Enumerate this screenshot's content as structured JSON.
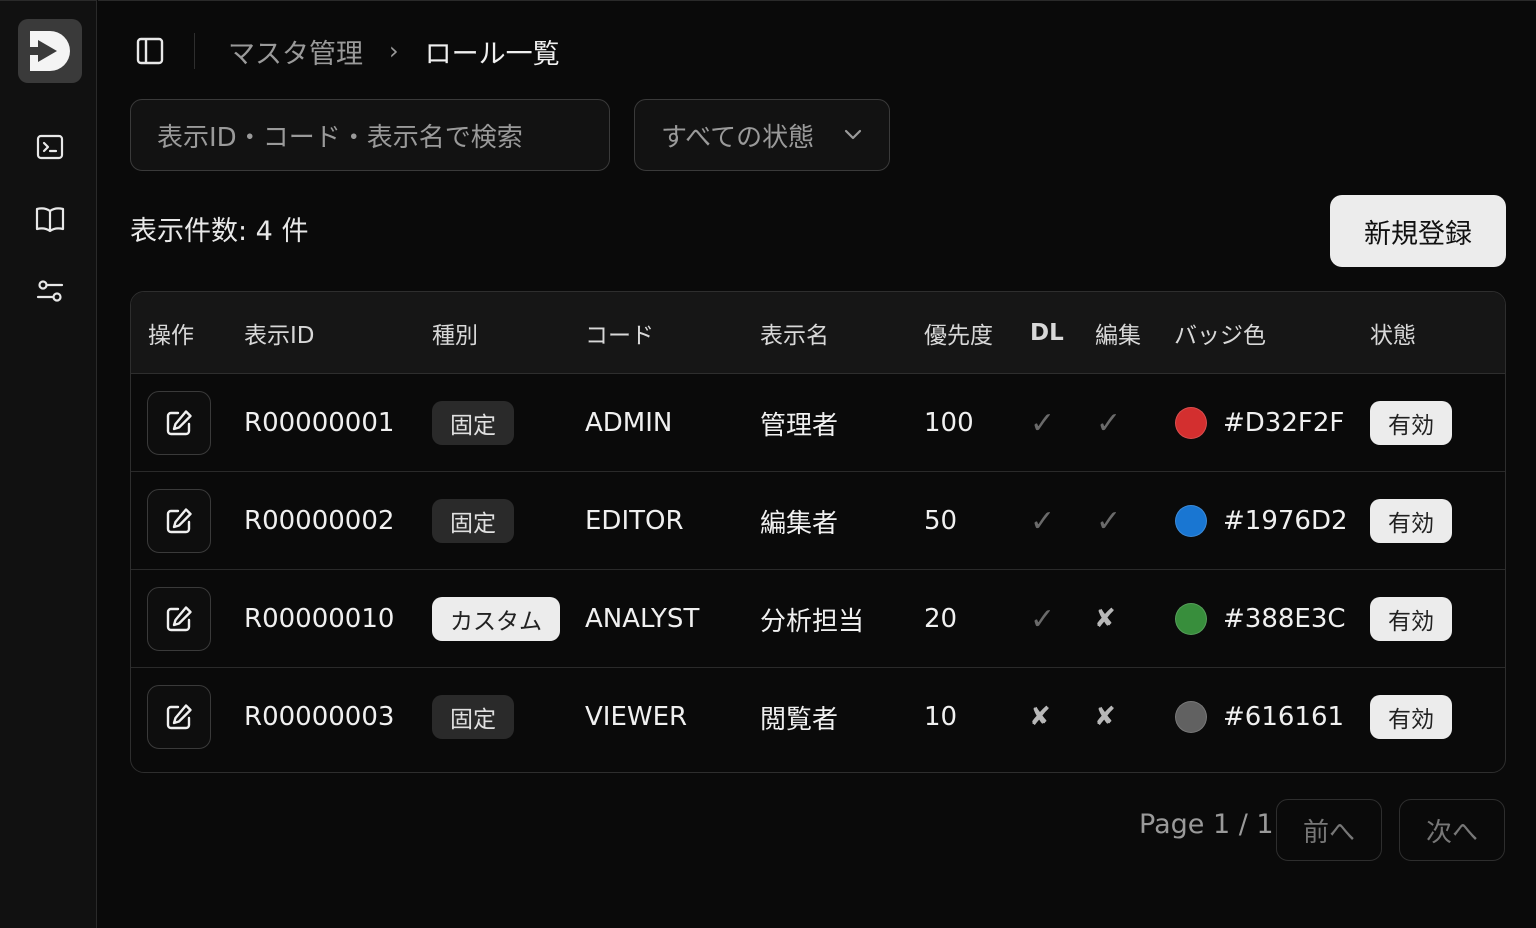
{
  "breadcrumb": {
    "parent": "マスタ管理",
    "separator": "›",
    "current": "ロール一覧"
  },
  "search": {
    "placeholder": "表示ID・コード・表示名で検索"
  },
  "filter": {
    "selected": "すべての状態"
  },
  "count_label": "表示件数: 4 件",
  "new_button": "新規登録",
  "table": {
    "headers": {
      "action": "操作",
      "display_id": "表示ID",
      "type": "種別",
      "code": "コード",
      "display_name": "表示名",
      "priority": "優先度",
      "dl": "DL",
      "edit": "編集",
      "badge_color": "バッジ色",
      "status": "状態"
    },
    "rows": [
      {
        "display_id": "R00000001",
        "type": "固定",
        "type_kind": "fixed",
        "code": "ADMIN",
        "display_name": "管理者",
        "priority": "100",
        "dl": true,
        "edit": true,
        "badge_color": "#D32F2F",
        "status": "有効"
      },
      {
        "display_id": "R00000002",
        "type": "固定",
        "type_kind": "fixed",
        "code": "EDITOR",
        "display_name": "編集者",
        "priority": "50",
        "dl": true,
        "edit": true,
        "badge_color": "#1976D2",
        "status": "有効"
      },
      {
        "display_id": "R00000010",
        "type": "カスタム",
        "type_kind": "custom",
        "code": "ANALYST",
        "display_name": "分析担当",
        "priority": "20",
        "dl": true,
        "edit": false,
        "badge_color": "#388E3C",
        "status": "有効"
      },
      {
        "display_id": "R00000003",
        "type": "固定",
        "type_kind": "fixed",
        "code": "VIEWER",
        "display_name": "閲覧者",
        "priority": "10",
        "dl": false,
        "edit": false,
        "badge_color": "#616161",
        "status": "有効"
      }
    ]
  },
  "pagination": {
    "info": "Page 1 / 1",
    "prev": "前へ",
    "next": "次へ"
  },
  "glyphs": {
    "check": "✓",
    "cross": "✘",
    "chevron": "⌄"
  },
  "icons": {
    "logo": "logo-icon",
    "terminal": "terminal-icon",
    "book": "book-icon",
    "settings": "settings-sliders-icon",
    "sidebar_toggle": "sidebar-toggle-icon",
    "edit": "edit-icon"
  }
}
